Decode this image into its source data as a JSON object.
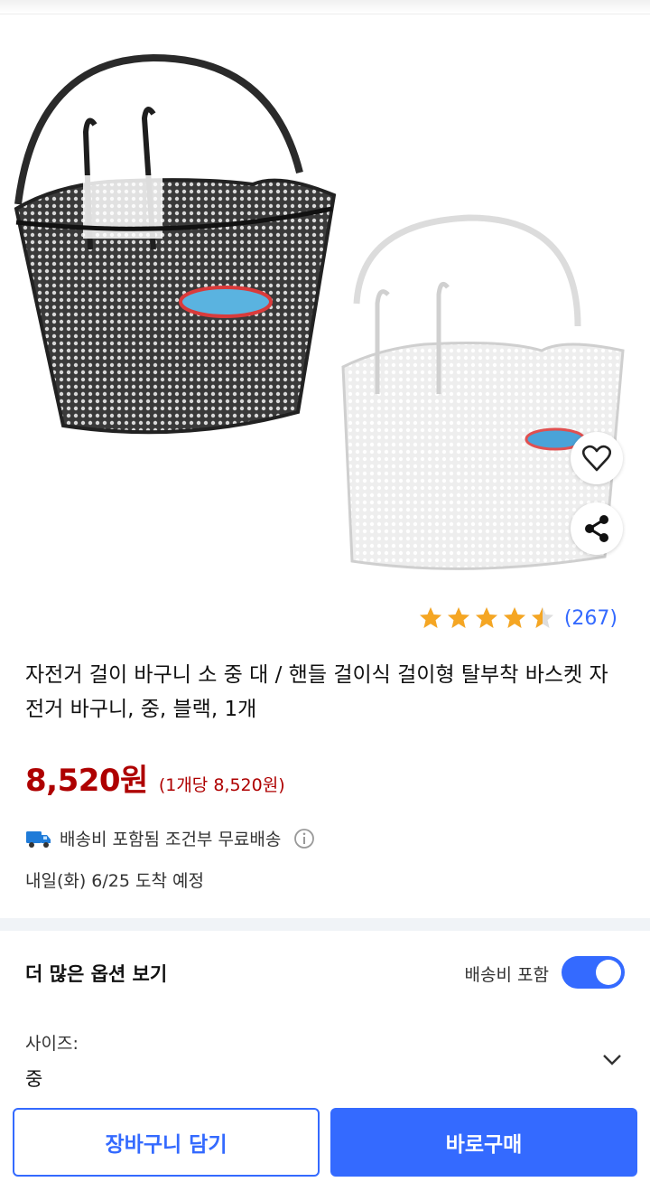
{
  "product": {
    "image_alt": "bicycle-basket-black-and-white",
    "rating_value": 4.5,
    "rating_max": 5,
    "rating_count": "(267)",
    "title": "자전거 걸이 바구니 소 중 대 / 핸들 걸이식 걸이형 탈부착 바스켓 자전거 바구니, 중, 블랙, 1개",
    "price": "8,520원",
    "unit_price": "(1개당 8,520원)",
    "shipping_text": "배송비 포함됨 조건부 무료배송",
    "delivery_date": "내일(화) 6/25 도착 예정"
  },
  "options": {
    "title": "더 많은 옵션 보기",
    "shipping_toggle_label": "배송비 포함",
    "shipping_toggle_on": true,
    "size_label": "사이즈:",
    "size_value": "중"
  },
  "actions": {
    "cart_label": "장바구니 담기",
    "buy_label": "바로구매"
  },
  "colors": {
    "accent": "#346aff",
    "price": "#ae0000",
    "star": "#f5a623"
  },
  "icons": [
    "heart-icon",
    "share-icon",
    "truck-icon",
    "info-icon",
    "chevron-down-icon",
    "star-icon"
  ]
}
